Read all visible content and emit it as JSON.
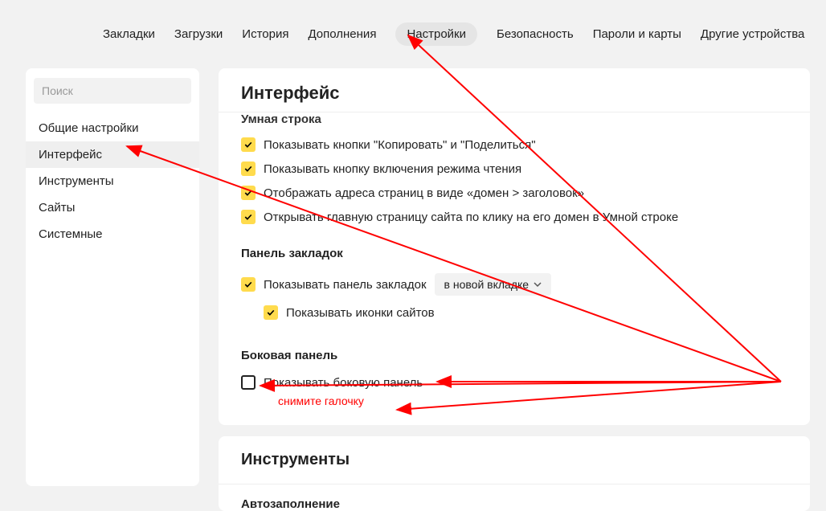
{
  "topnav": {
    "items": [
      "Закладки",
      "Загрузки",
      "История",
      "Дополнения",
      "Настройки",
      "Безопасность",
      "Пароли и карты",
      "Другие устройства"
    ],
    "active_index": 4
  },
  "sidebar": {
    "search_placeholder": "Поиск",
    "items": [
      "Общие настройки",
      "Интерфейс",
      "Инструменты",
      "Сайты",
      "Системные"
    ],
    "active_index": 1
  },
  "interface": {
    "title": "Интерфейс",
    "smart_line": {
      "title": "Умная строка",
      "opt_copy_share": "Показывать кнопки \"Копировать\" и \"Поделиться\"",
      "opt_reader": "Показывать кнопку включения режима чтения",
      "opt_domain_title": "Отображать адреса страниц в виде «домен > заголовок»",
      "opt_open_main": "Открывать главную страницу сайта по клику на его домен в Умной строке"
    },
    "bookmarks": {
      "title": "Панель закладок",
      "opt_show": "Показывать панель закладок",
      "dropdown": "в новой вкладке",
      "opt_icons": "Показывать иконки сайтов"
    },
    "sidepanel": {
      "title": "Боковая панель",
      "opt_show": "Показывать боковую панель"
    },
    "annotation": "снимите галочку"
  },
  "tools": {
    "title": "Инструменты",
    "autofill": "Автозаполнение"
  }
}
